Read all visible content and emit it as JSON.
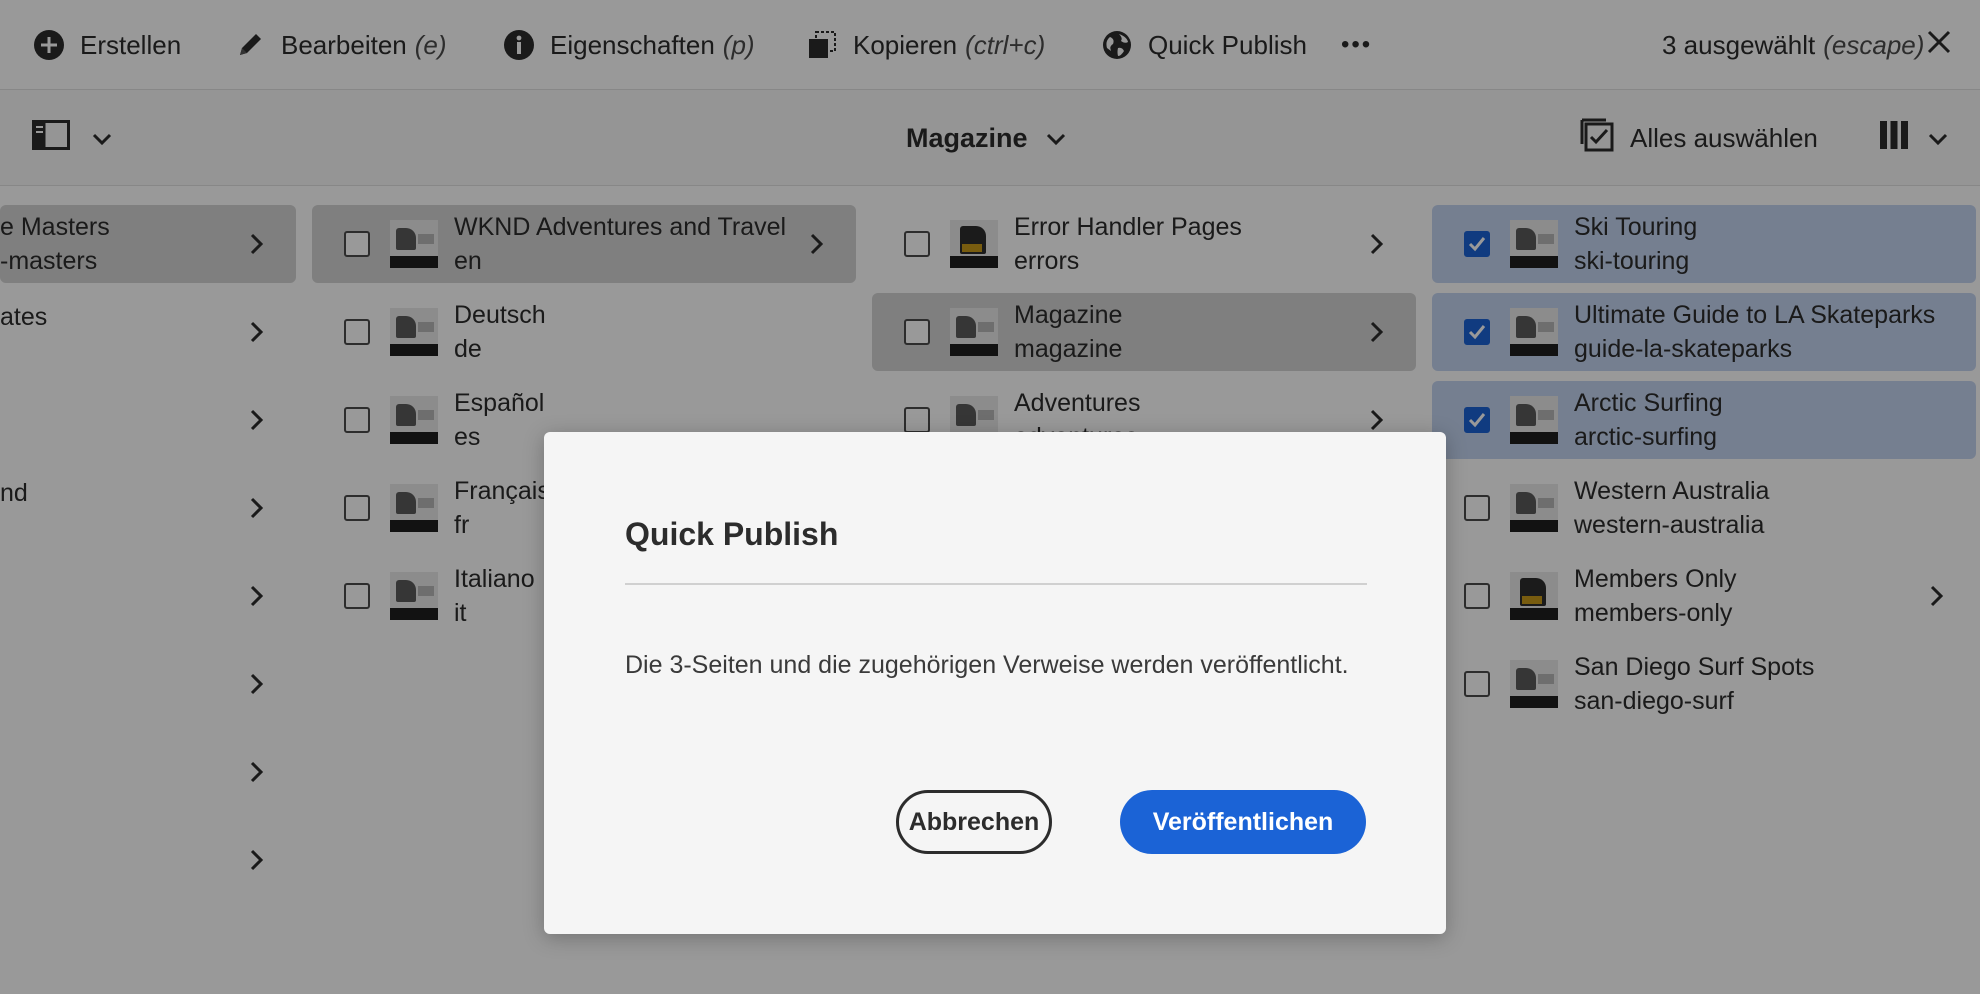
{
  "actionbar": {
    "create": {
      "label": "Erstellen",
      "shortcut": ""
    },
    "edit": {
      "label": "Bearbeiten",
      "shortcut": "(e)"
    },
    "properties": {
      "label": "Eigenschaften",
      "shortcut": "(p)"
    },
    "copy": {
      "label": "Kopieren",
      "shortcut": "(ctrl+c)"
    },
    "quick_publish": {
      "label": "Quick Publish"
    },
    "more": "•••",
    "selection": {
      "label": "3 ausgewählt",
      "shortcut": "(escape)"
    }
  },
  "subbar": {
    "column_title": "Magazine",
    "select_all": "Alles auswählen"
  },
  "columns": {
    "col1": [
      {
        "title": "e Masters",
        "subtitle": "-masters",
        "highlighted": true
      },
      {
        "title": "ates",
        "subtitle": ""
      },
      {
        "title": "",
        "subtitle": ""
      },
      {
        "title": "nd",
        "subtitle": ""
      },
      {
        "title": "",
        "subtitle": ""
      },
      {
        "title": "",
        "subtitle": ""
      },
      {
        "title": "",
        "subtitle": ""
      },
      {
        "title": "",
        "subtitle": ""
      }
    ],
    "col2": [
      {
        "title": "WKND Adventures and Travel",
        "subtitle": "en",
        "highlighted": true
      },
      {
        "title": "Deutsch",
        "subtitle": "de"
      },
      {
        "title": "Español",
        "subtitle": "es"
      },
      {
        "title": "Français",
        "subtitle": "fr"
      },
      {
        "title": "Italiano",
        "subtitle": "it"
      }
    ],
    "col3": [
      {
        "title": "Error Handler Pages",
        "subtitle": "errors"
      },
      {
        "title": "Magazine",
        "subtitle": "magazine",
        "highlighted": true
      },
      {
        "title": "Adventures",
        "subtitle": "adventures"
      }
    ],
    "col4": [
      {
        "title": "Ski Touring",
        "subtitle": "ski-touring",
        "checked": true
      },
      {
        "title": "Ultimate Guide to LA Skateparks",
        "subtitle": "guide-la-skateparks",
        "checked": true
      },
      {
        "title": "Arctic Surfing",
        "subtitle": "arctic-surfing",
        "checked": true
      },
      {
        "title": "Western Australia",
        "subtitle": "western-australia",
        "checked": false
      },
      {
        "title": "Members Only",
        "subtitle": "members-only",
        "checked": false
      },
      {
        "title": "San Diego Surf Spots",
        "subtitle": "san-diego-surf",
        "checked": false
      }
    ]
  },
  "dialog": {
    "title": "Quick Publish",
    "body": "Die 3-Seiten und die zugehörigen Verweise werden veröffentlicht.",
    "cancel_label": "Abbrechen",
    "confirm_label": "Veröffentlichen"
  },
  "colors": {
    "primary": "#1b63d6",
    "selected_row": "#c4d4f0",
    "overlay": "rgba(0,0,0,0.4)"
  }
}
